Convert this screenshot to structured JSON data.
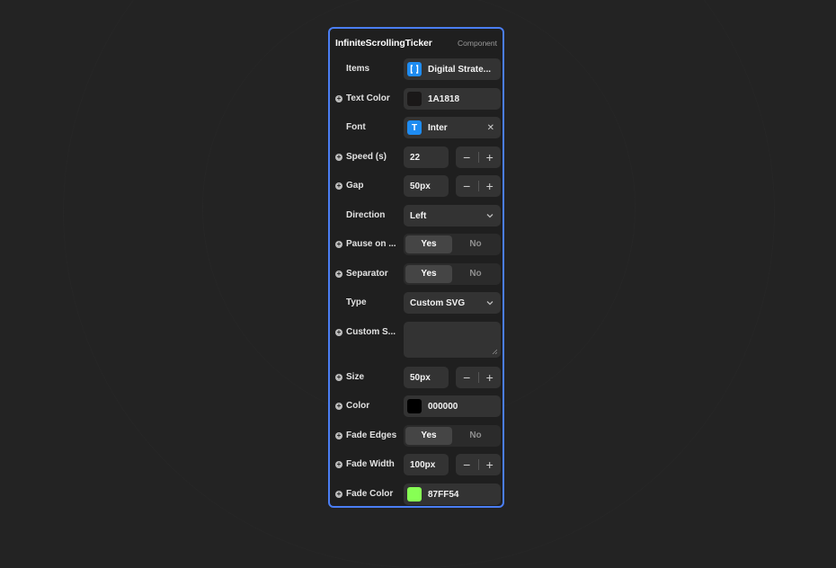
{
  "panel": {
    "title": "InfiniteScrollingTicker",
    "tag": "Component"
  },
  "rows": {
    "items": {
      "label": "Items",
      "value": "Digital Strate..."
    },
    "text_color": {
      "label": "Text Color",
      "value": "1A1818",
      "swatch": "#1a1818"
    },
    "font": {
      "label": "Font",
      "value": "Inter",
      "icon": "T"
    },
    "speed": {
      "label": "Speed (s)",
      "value": "22"
    },
    "gap": {
      "label": "Gap",
      "value": "50px"
    },
    "direction": {
      "label": "Direction",
      "value": "Left"
    },
    "pause": {
      "label": "Pause on ...",
      "yes": "Yes",
      "no": "No",
      "selected": "Yes"
    },
    "separator": {
      "label": "Separator",
      "yes": "Yes",
      "no": "No",
      "selected": "Yes"
    },
    "type": {
      "label": "Type",
      "value": "Custom SVG"
    },
    "custom_svg": {
      "label": "Custom S...",
      "value": ""
    },
    "size": {
      "label": "Size",
      "value": "50px"
    },
    "color": {
      "label": "Color",
      "value": "000000",
      "swatch": "#000000"
    },
    "fade_edges": {
      "label": "Fade Edges",
      "yes": "Yes",
      "no": "No",
      "selected": "Yes"
    },
    "fade_width": {
      "label": "Fade Width",
      "value": "100px"
    },
    "fade_color": {
      "label": "Fade Color",
      "value": "87FF54",
      "swatch": "#87ff54"
    }
  },
  "icons": {
    "add": "plus-circle-icon",
    "array": "array-brackets-icon",
    "font": "font-type-icon",
    "chevron": "chevron-down-icon",
    "clear": "close-icon",
    "minus": "minus-icon",
    "plus": "plus-icon"
  },
  "colors": {
    "accent": "#4a7ef4",
    "chip_blue": "#1e8cf2"
  }
}
